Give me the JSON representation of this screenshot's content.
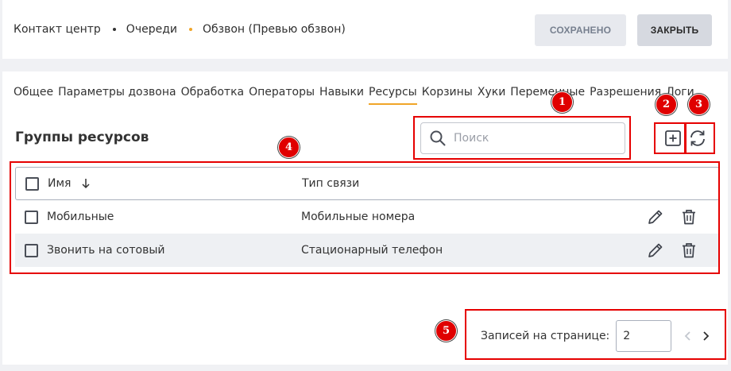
{
  "header": {
    "breadcrumbs": [
      {
        "label": "Контакт центр",
        "dot_color": ""
      },
      {
        "label": "Очереди",
        "dot_color": "#333333"
      },
      {
        "label": "Обзвон (Превью обзвон)",
        "dot_color": "#f0a528"
      }
    ],
    "saved_label": "СОХРАНЕНО",
    "close_label": "ЗАКРЫТЬ"
  },
  "tabs": [
    {
      "label": "Общее"
    },
    {
      "label": "Параметры дозвона"
    },
    {
      "label": "Обработка"
    },
    {
      "label": "Операторы"
    },
    {
      "label": "Навыки"
    },
    {
      "label": "Ресурсы",
      "active": true
    },
    {
      "label": "Корзины"
    },
    {
      "label": "Хуки"
    },
    {
      "label": "Переменные"
    },
    {
      "label": "Разрешения"
    },
    {
      "label": "Логи"
    }
  ],
  "section": {
    "title": "Группы ресурсов",
    "search_placeholder": "Поиск",
    "add_icon": "add-square-icon",
    "refresh_icon": "refresh-icon"
  },
  "table": {
    "columns": [
      "Имя",
      "Тип связи"
    ],
    "sort_icon": "arrow-down-icon",
    "rows": [
      {
        "name": "Мобильные",
        "type": "Мобильные номера"
      },
      {
        "name": "Звонить на сотовый",
        "type": "Стационарный телефон"
      }
    ]
  },
  "pagination": {
    "label": "Записей на странице:",
    "value": "2"
  },
  "annotations": [
    "1",
    "2",
    "3",
    "4",
    "5"
  ],
  "colors": {
    "accent": "#f0a528",
    "annotation": "#e60000"
  }
}
